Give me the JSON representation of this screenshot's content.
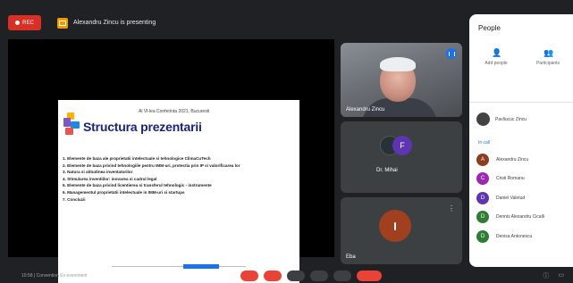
{
  "window": {
    "recording_label": "REC"
  },
  "header": {
    "presenting_text": "Alexandru Zincu is presenting"
  },
  "slide": {
    "header_small": "Al Vl-lea Conferinta 2021, Bucuresti",
    "title": "Structura prezentarii",
    "items": [
      "1. Elemente de baza ale proprietatii intelectuale si tehnologice ClimaCuTech",
      "2. Elemente de baza privind tehnologiile pentru IMM-uri, protectia prin IP si valorificarea lor",
      "3. Natura si atitudinea inventatorilor",
      "4. Stimularea inventiilor: inovarea si cadrul legal",
      "5. Elemente de baza privind licentierea si transferul tehnologic - instrumente",
      "6. Managementul proprietatii intelectuale in IMM-uri si startups",
      "7. Concluzii"
    ]
  },
  "tiles": [
    {
      "name": "Alexandru Zincu",
      "kind": "video"
    },
    {
      "name": "Dr. Mihai",
      "avatar_letter": "F",
      "kind": "avatars"
    },
    {
      "name": "Eba",
      "kind": "avatar"
    }
  ],
  "panel": {
    "title": "People",
    "actions": [
      {
        "label": "Add people",
        "icon": "add-person-icon"
      },
      {
        "label": "Participants",
        "icon": "people-icon"
      }
    ],
    "host_name": "Pavliucuc Zincu",
    "in_call_label": "In call",
    "participants": [
      {
        "name": "Alexandru Zincu",
        "initial": "A",
        "color": "#8d3d1f"
      },
      {
        "name": "Cristi Romanu",
        "initial": "C",
        "color": "#9c27b0"
      },
      {
        "name": "Daniel Valetud",
        "initial": "D",
        "color": "#5e35b1"
      },
      {
        "name": "Dennis Alexandru Cicalli",
        "initial": "D",
        "color": "#2e7d32"
      },
      {
        "name": "Denisa Antonescu",
        "initial": "D",
        "color": "#2e7d32"
      }
    ]
  },
  "bottom": {
    "meeting_info": "10:58 | Convention Ev eveniment"
  },
  "colors": {
    "accent": "#1a73e8",
    "danger": "#ea4335",
    "background": "#202124"
  }
}
